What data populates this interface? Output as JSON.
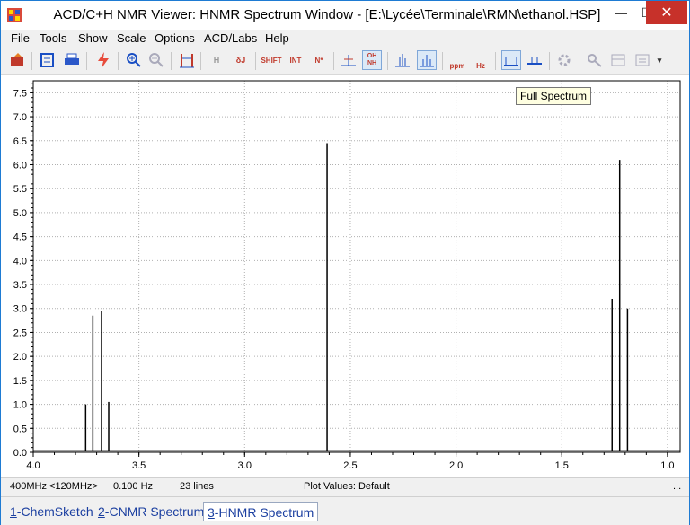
{
  "window": {
    "title": "ACD/C+H NMR Viewer: HNMR Spectrum Window - [E:\\Lycée\\Terminale\\RMN\\ethanol.HSP]"
  },
  "titlebar_buttons": {
    "minimize": "—",
    "maximize": "☐",
    "close": "✕"
  },
  "menu": [
    {
      "label": "File"
    },
    {
      "label": "Tools"
    },
    {
      "label": "Show"
    },
    {
      "label": "Scale"
    },
    {
      "label": "Options"
    },
    {
      "label": "ACD/Labs"
    },
    {
      "label": "Help"
    }
  ],
  "toolbar": {
    "shift_label": "SHIFT",
    "int_label": "INT",
    "nstar_label": "N*",
    "oh_label": "OH",
    "nh_label": "NH",
    "ppm_label": "ppm",
    "hz_label": "Hz",
    "h_label": "H",
    "j_label": "δJ",
    "more_label": "▾"
  },
  "tooltip": "Full Spectrum",
  "status": {
    "freq": "400MHz <120MHz>",
    "resolution": "0.100 Hz",
    "lines": "23 lines",
    "plot_values": "Plot Values: Default",
    "ellipsis": "..."
  },
  "tabs": [
    {
      "num": "1",
      "label": "-ChemSketch",
      "active": false
    },
    {
      "num": "2",
      "label": "-CNMR Spectrum",
      "active": false
    },
    {
      "num": "3",
      "label": "-HNMR Spectrum",
      "active": true
    }
  ],
  "chart_data": {
    "type": "line",
    "title": "",
    "xlabel": "",
    "ylabel": "",
    "xlim": [
      4.0,
      0.94
    ],
    "ylim": [
      0.0,
      7.75
    ],
    "x_reversed": true,
    "x_ticks": [
      "4.0",
      "3.5",
      "3.0",
      "2.5",
      "2.0",
      "1.5",
      "1.0"
    ],
    "y_ticks": [
      "0.0",
      "0.5",
      "1.0",
      "1.5",
      "2.0",
      "2.5",
      "3.0",
      "3.5",
      "4.0",
      "4.5",
      "5.0",
      "5.5",
      "6.0",
      "6.5",
      "7.0",
      "7.5"
    ],
    "grid": true,
    "peaks": [
      {
        "x": 3.752,
        "y": 1.0
      },
      {
        "x": 3.718,
        "y": 2.85
      },
      {
        "x": 3.677,
        "y": 2.95
      },
      {
        "x": 3.643,
        "y": 1.05
      },
      {
        "x": 2.61,
        "y": 6.45
      },
      {
        "x": 1.262,
        "y": 3.2
      },
      {
        "x": 1.226,
        "y": 6.1
      },
      {
        "x": 1.189,
        "y": 3.0
      }
    ]
  }
}
